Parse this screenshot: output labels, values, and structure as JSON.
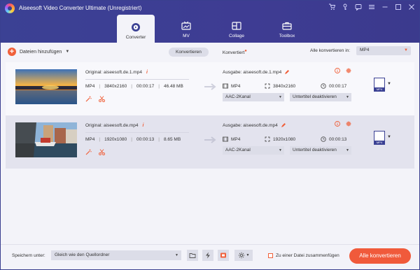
{
  "window": {
    "title": "Aiseesoft Video Converter Ultimate (Unregistriert)",
    "icons": [
      "cart-icon",
      "key-icon",
      "feedback-icon",
      "menu-icon",
      "minimize-icon",
      "maximize-icon",
      "close-icon"
    ]
  },
  "tabs": [
    {
      "label": "Converter",
      "icon": "converter-icon",
      "active": true
    },
    {
      "label": "MV",
      "icon": "tv-icon",
      "active": false
    },
    {
      "label": "Collage",
      "icon": "collage-icon",
      "active": false
    },
    {
      "label": "Toolbox",
      "icon": "toolbox-icon",
      "active": false
    }
  ],
  "toolbar": {
    "add_files_label": "Dateien hinzufügen",
    "converting_label": "Konvertieren",
    "converted_label": "Konvertiert",
    "convert_all_to_label": "Alle konvertieren in:",
    "convert_all_format": "MP4"
  },
  "files": [
    {
      "original": "Original: aiseesoft.de.1.mp4",
      "format": "MP4",
      "resolution": "3840x2160",
      "duration": "00:00:17",
      "size": "46.48 MB",
      "output_name": "Ausgabe: aiseesoft.de.1.mp4",
      "out_format": "MP4",
      "out_resolution": "3840x2160",
      "out_duration": "00:00:17",
      "audio": "AAC-2Kanal",
      "subtitle": "Untertitel deaktivieren",
      "format_badge": "MP4"
    },
    {
      "original": "Original: aiseesoft.de.mp4",
      "format": "MP4",
      "resolution": "1920x1080",
      "duration": "00:00:13",
      "size": "8.65 MB",
      "output_name": "Ausgabe: aiseesoft.de.mp4",
      "out_format": "MP4",
      "out_resolution": "1920x1080",
      "out_duration": "00:00:13",
      "audio": "AAC-2Kanal",
      "subtitle": "Untertitel deaktivieren",
      "format_badge": "MP4"
    }
  ],
  "bottom": {
    "save_to_label": "Speichern unter:",
    "save_path": "Gleich wie den Quellordner",
    "merge_label": "Zu einer Datei zusammenfügen",
    "convert_all_button": "Alle konvertieren"
  },
  "colors": {
    "header": "#3b4194",
    "accent": "#f0603a",
    "row_alt": "#e3e3ee"
  }
}
